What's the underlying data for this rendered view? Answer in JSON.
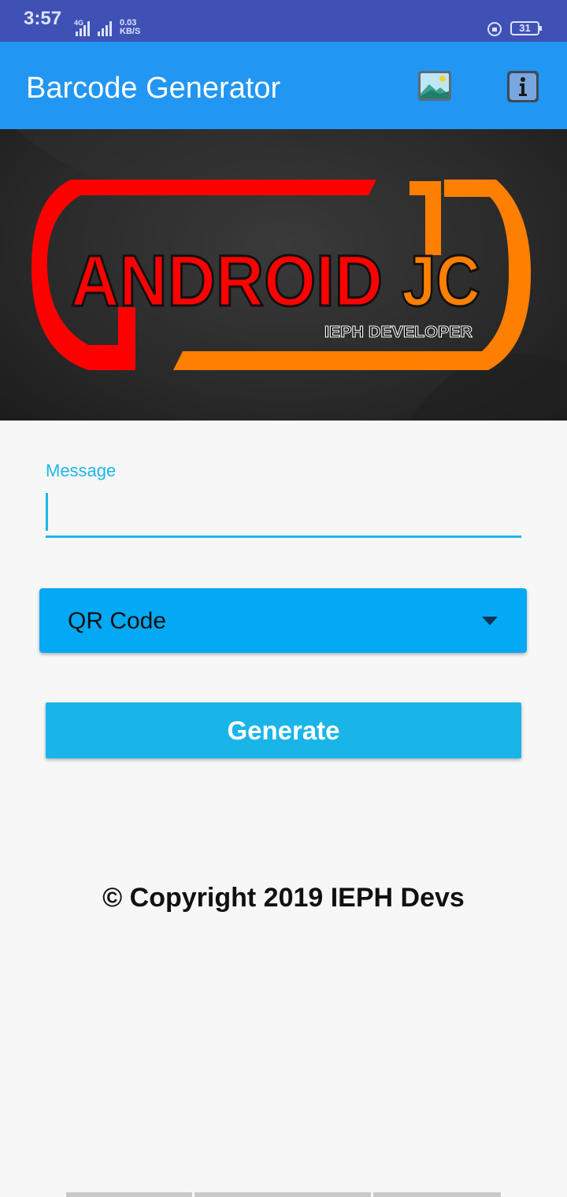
{
  "status_bar": {
    "time": "3:57",
    "network_type": "4G",
    "speed_value": "0.03",
    "speed_unit": "KB/S",
    "battery": "31"
  },
  "app_bar": {
    "title": "Barcode Generator",
    "actions": [
      {
        "icon": "image-icon"
      },
      {
        "icon": "info-icon"
      }
    ]
  },
  "banner": {
    "logo_text_red": "ANDROID",
    "logo_text_orange": "JC",
    "logo_subtitle": "IEPH DEVELOPER",
    "colors": {
      "red": "#ff0000",
      "orange": "#ff8000",
      "background": "#2a2a2a"
    }
  },
  "form": {
    "message_label": "Message",
    "message_value": "",
    "barcode_type": {
      "selected": "QR Code"
    },
    "generate_label": "Generate"
  },
  "footer": {
    "copyright": "© Copyright 2019 IEPH Devs"
  },
  "colors": {
    "status_bar": "#3f51b5",
    "app_bar": "#2196f3",
    "accent": "#1fb6e8",
    "dropdown": "#03a9f4"
  }
}
